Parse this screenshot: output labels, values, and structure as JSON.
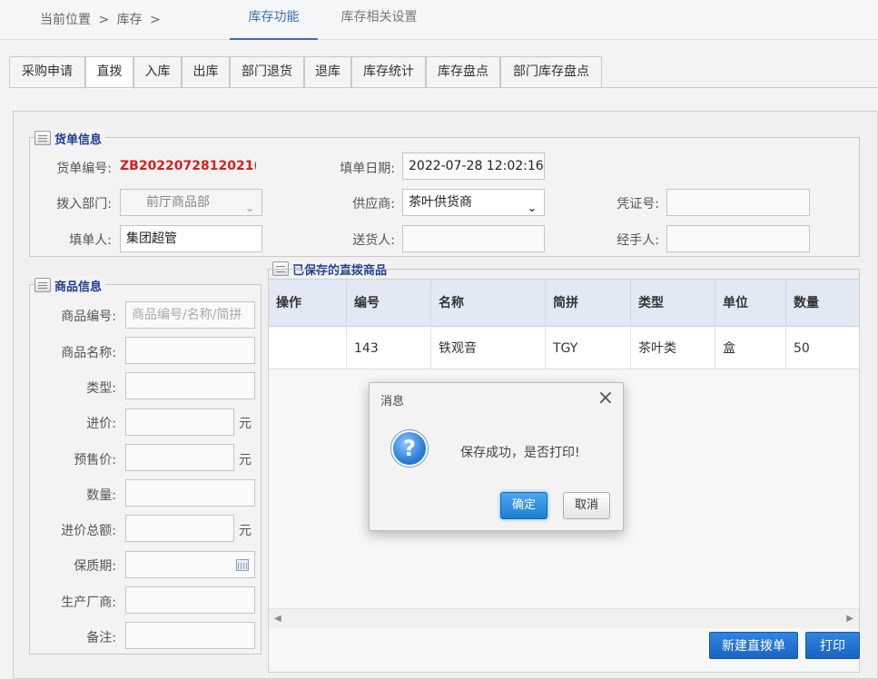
{
  "breadcrumb": {
    "prefix": "当前位置",
    "sep1": ">",
    "item": "库存",
    "sep2": ">"
  },
  "top_tabs": [
    {
      "label": "库存功能",
      "active": true
    },
    {
      "label": "库存相关设置",
      "active": false
    }
  ],
  "sub_tabs": [
    {
      "label": "采购申请"
    },
    {
      "label": "直拨",
      "active": true
    },
    {
      "label": "入库"
    },
    {
      "label": "出库"
    },
    {
      "label": "部门退货"
    },
    {
      "label": "退库"
    },
    {
      "label": "库存统计"
    },
    {
      "label": "库存盘点"
    },
    {
      "label": "部门库存盘点"
    }
  ],
  "order_info": {
    "legend": "货单信息",
    "order_no_label": "货单编号:",
    "order_no": "ZB2022072812021(",
    "date_label": "填单日期:",
    "date": "2022-07-28 12:02:16",
    "dept_label": "拨入部门:",
    "dept": "前厅商品部",
    "supplier_label": "供应商:",
    "supplier": "茶叶供货商",
    "voucher_label": "凭证号:",
    "voucher": "",
    "filler_label": "填单人:",
    "filler": "集团超管",
    "deliverer_label": "送货人:",
    "deliverer": "",
    "handler_label": "经手人:",
    "handler": ""
  },
  "product_info": {
    "legend": "商品信息",
    "code_label": "商品编号:",
    "code_placeholder": "商品编号/名称/简拼",
    "name_label": "商品名称:",
    "type_label": "类型:",
    "price_label": "进价:",
    "presale_label": "预售价:",
    "qty_label": "数量:",
    "total_label": "进价总额:",
    "shelf_label": "保质期:",
    "maker_label": "生产厂商:",
    "note_label": "备注:",
    "unit_yuan": "元"
  },
  "saved": {
    "legend": "已保存的直拨商品",
    "columns": [
      "操作",
      "编号",
      "名称",
      "简拼",
      "类型",
      "单位",
      "数量"
    ],
    "rows": [
      {
        "op": "",
        "code": "143",
        "name": "铁观音",
        "abbr": "TGY",
        "type": "茶叶类",
        "unit": "盒",
        "qty": "50"
      }
    ]
  },
  "actions": {
    "new_label": "新建直拨单",
    "print_label": "打印"
  },
  "dialog": {
    "title": "消息",
    "message": "保存成功，是否打印!",
    "ok_label": "确定",
    "cancel_label": "取消",
    "icon": "question-icon"
  }
}
